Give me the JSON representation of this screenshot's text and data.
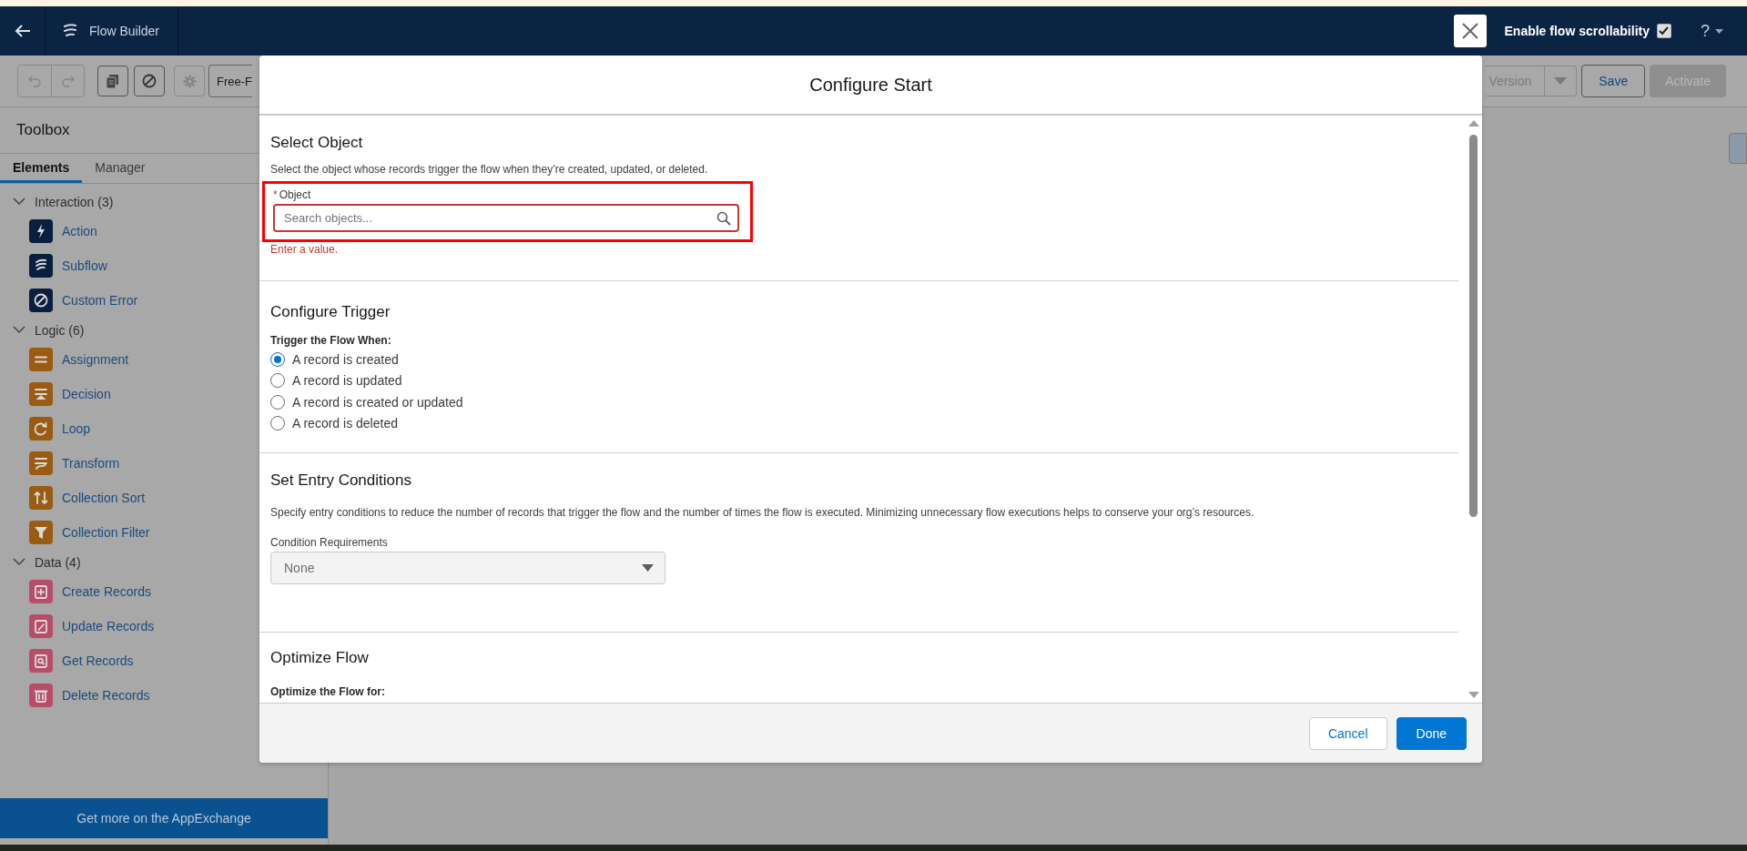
{
  "header": {
    "title": "Flow Builder",
    "scroll_toggle": {
      "label": "Enable flow scrollability",
      "checked": true
    },
    "help": "?"
  },
  "toolbar": {
    "mode_button": "Free-F",
    "version_button": "Version",
    "save": "Save",
    "activate": "Activate"
  },
  "sidebar": {
    "title": "Toolbox",
    "tabs": [
      {
        "label": "Elements",
        "selected": true
      },
      {
        "label": "Manager",
        "selected": false
      }
    ],
    "groups": [
      {
        "label": "Interaction (3)",
        "kind": "interaction",
        "expanded": true,
        "items": [
          {
            "label": "Action",
            "kind": "action"
          },
          {
            "label": "Subflow",
            "kind": "subflow"
          },
          {
            "label": "Custom Error",
            "kind": "error"
          }
        ]
      },
      {
        "label": "Logic (6)",
        "kind": "logic",
        "expanded": true,
        "items": [
          {
            "label": "Assignment",
            "kind": "assignment"
          },
          {
            "label": "Decision",
            "kind": "decision"
          },
          {
            "label": "Loop",
            "kind": "loop"
          },
          {
            "label": "Transform",
            "kind": "transform"
          },
          {
            "label": "Collection Sort",
            "kind": "sort"
          },
          {
            "label": "Collection Filter",
            "kind": "filter"
          }
        ]
      },
      {
        "label": "Data (4)",
        "kind": "data",
        "expanded": true,
        "items": [
          {
            "label": "Create Records",
            "kind": "create"
          },
          {
            "label": "Update Records",
            "kind": "update"
          },
          {
            "label": "Get Records",
            "kind": "get"
          },
          {
            "label": "Delete Records",
            "kind": "delete"
          }
        ]
      }
    ],
    "footer": "Get more on the AppExchange"
  },
  "modal": {
    "title": "Configure Start",
    "select_object": {
      "heading": "Select Object",
      "description": "Select the object whose records trigger the flow when they’re created, updated, or deleted.",
      "field": {
        "label": "Object",
        "required": true,
        "required_mark": "*",
        "placeholder": "Search objects...",
        "error": "Enter a value.",
        "highlighted": true
      }
    },
    "trigger": {
      "heading": "Configure Trigger",
      "label": "Trigger the Flow When:",
      "options": [
        {
          "label": "A record is created",
          "selected": true
        },
        {
          "label": "A record is updated",
          "selected": false
        },
        {
          "label": "A record is created or updated",
          "selected": false
        },
        {
          "label": "A record is deleted",
          "selected": false
        }
      ]
    },
    "entry_conditions": {
      "heading": "Set Entry Conditions",
      "description": "Specify entry conditions to reduce the number of records that trigger the flow and the number of times the flow is executed. Minimizing unnecessary flow executions helps to conserve your org’s resources.",
      "select_label": "Condition Requirements",
      "select_value": "None",
      "disabled": true
    },
    "optimize": {
      "heading": "Optimize Flow",
      "label": "Optimize the Flow for:"
    },
    "buttons": {
      "cancel": "Cancel",
      "done": "Done"
    }
  }
}
